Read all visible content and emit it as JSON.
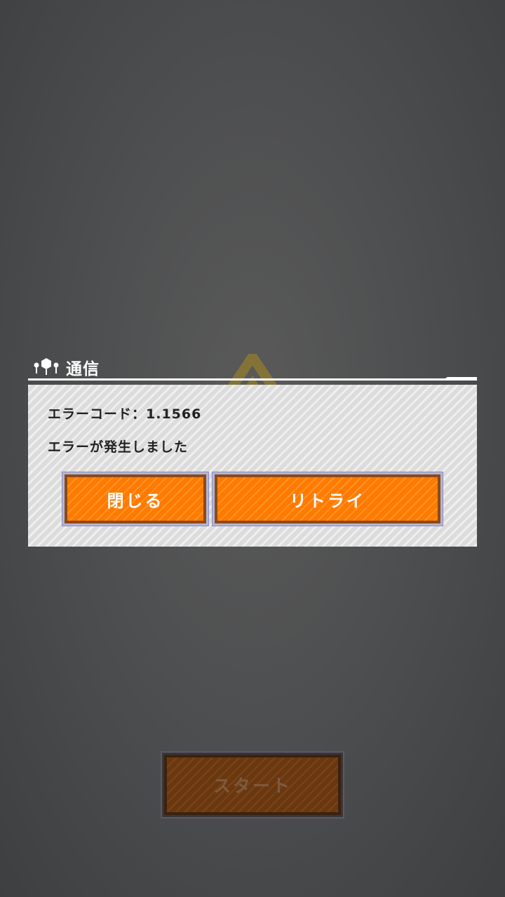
{
  "dialog": {
    "title": "通信",
    "title_icon": "network-nodes-icon",
    "error_code_label": "エラーコード：1.1566",
    "message": "エラーが発生しました",
    "close_label": "閉じる",
    "retry_label": "リトライ"
  },
  "background": {
    "emblem_icon": "diamond-emblem-icon",
    "start_label": "スタート",
    "start_enabled": false
  },
  "colors": {
    "accent_orange": "#ff7a00",
    "button_border": "#8a4a1c",
    "dialog_bg": "#dcdcdc",
    "emblem": "#b89a2a"
  }
}
